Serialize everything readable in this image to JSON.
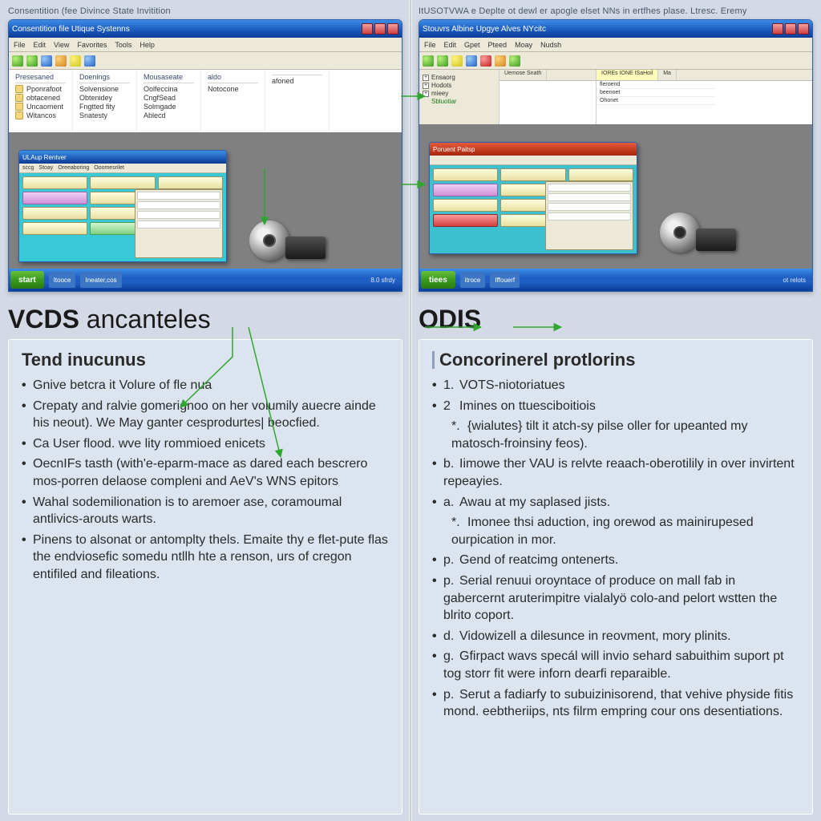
{
  "left": {
    "caption": "Consentition (fee Divince State Invitition",
    "titlebar": "Consentition file Utique Systenns",
    "menu": [
      "File",
      "Edit",
      "View",
      "Favorites",
      "Tools",
      "Help"
    ],
    "filecols": {
      "c1": {
        "head": "Presesaned",
        "rows": [
          "Pponrafoot",
          "obtacened",
          "Uncaoment",
          "Witancos"
        ]
      },
      "c2": {
        "head": "Doenings",
        "rows": [
          "Solvensione",
          "Obtenidey",
          "Fngtted fity",
          "Snatesty"
        ]
      },
      "c3": {
        "head": "Mousaseate",
        "rows": [
          "Oolfeccina",
          "CngfSead",
          "Solmgade",
          "Ablecd"
        ]
      },
      "c4": {
        "head": "aldo",
        "rows": [
          "Notocone"
        ]
      },
      "c5": {
        "head": "",
        "rows": [
          "afoned"
        ]
      }
    },
    "inner_title": "ULAup  Rentver",
    "inner_menu": [
      "sccg",
      "Stoay",
      "Oreeaboring",
      "Ooomesrilet"
    ],
    "start": "start",
    "tb_items": [
      "Itooce",
      "Ineater,cos"
    ],
    "tray": "8.0 sfrdy",
    "heading_main": "VCDS",
    "heading_light": "ancanteles",
    "subhead": "Tend inucunus",
    "bullets": [
      "Gnive betcra it Volure of fle nua",
      "Crepaty and ralvie gomerignoo on her volumily auecre ainde his neout). We May ganter cesprodurtes| beocfied.",
      "Ca User flood. wve lity rommioed enicets",
      "OecnIFs tasth (with'e-eparm-mace as dared each bescrero mos-porren delaose compleni and AeV's WNS epitors",
      "Wahal sodemilionation is to aremoer ase, coramoumal antlivics-arouts warts.",
      "Pinens to alsonat or antomplty thels. Emaite thy e flet-pute flas the endviosefic somedu ntllh hte a renson, urs of cregon entifiled and fileations."
    ]
  },
  "right": {
    "caption": "ItUSOTVWA e Deplte ot dewl er apogle elset NNs in ertfhes plase. Ltresc. Eremy",
    "titlebar": "Stouvrs Albine Upgye Alves NYcitc",
    "menu": [
      "File",
      "Edit",
      "Gpet",
      "Pteed",
      "Moay",
      "Nudsh"
    ],
    "tree": [
      "Ensaorg",
      "Hodots",
      "mieey",
      "Sbluotiar"
    ],
    "tabs": [
      "Uemose Snath",
      "",
      "",
      "",
      ""
    ],
    "tabs_r": [
      "IOREs IONE ISaHoil",
      "Ma"
    ],
    "lines": [
      "fleroend",
      "beenoet",
      "Ohonet"
    ],
    "inner_title": "Poruent  Paitsp",
    "start": "tiees",
    "tb_items": [
      "itroce",
      "Iffouerf"
    ],
    "tray": "ot relots",
    "heading_main": "ODIS",
    "subhead": "Concorinerel protlorins",
    "bullets": [
      {
        "lbl": "1.",
        "txt": "VOTS-niotoriatues"
      },
      {
        "lbl": "2",
        "txt": "Imines on ttuesciboitiois"
      },
      {
        "lbl": "*.",
        "txt": "{wialutes} tilt it atch-sy pilse oller for upeanted my matosch-froinsiny feos)."
      },
      {
        "lbl": "b.",
        "txt": "Iimowe ther VAU is relvte reaach-oberotilily in over invirtent repeayies."
      },
      {
        "lbl": "a.",
        "txt": "Awau at my saplased jists."
      },
      {
        "lbl": "*.",
        "txt": "Imonee thsi aduction, ing orewod as mainirupesed ourpication in mor."
      },
      {
        "lbl": "p.",
        "txt": "Gend of reatcimg ontenerts."
      },
      {
        "lbl": "p.",
        "txt": "Serial renuui oroyntace of produce on mall fab in gabercernt aruterimpitre vialalyö colo-and pelort wstten the blrito coport."
      },
      {
        "lbl": "d.",
        "txt": "Vidowizell a dilesunce in reovment, mory plinits."
      },
      {
        "lbl": "g.",
        "txt": "Gfirpact wavs specál will invio sehard sabuithim suport pt tog storr fit were inforn dearfi reparaible."
      },
      {
        "lbl": "p.",
        "txt": "Serut a fadiarfy to subuizinisorend, that vehive physide fitis mond. eebtheriips, nts filrm empring cour ons desentiations."
      }
    ]
  }
}
